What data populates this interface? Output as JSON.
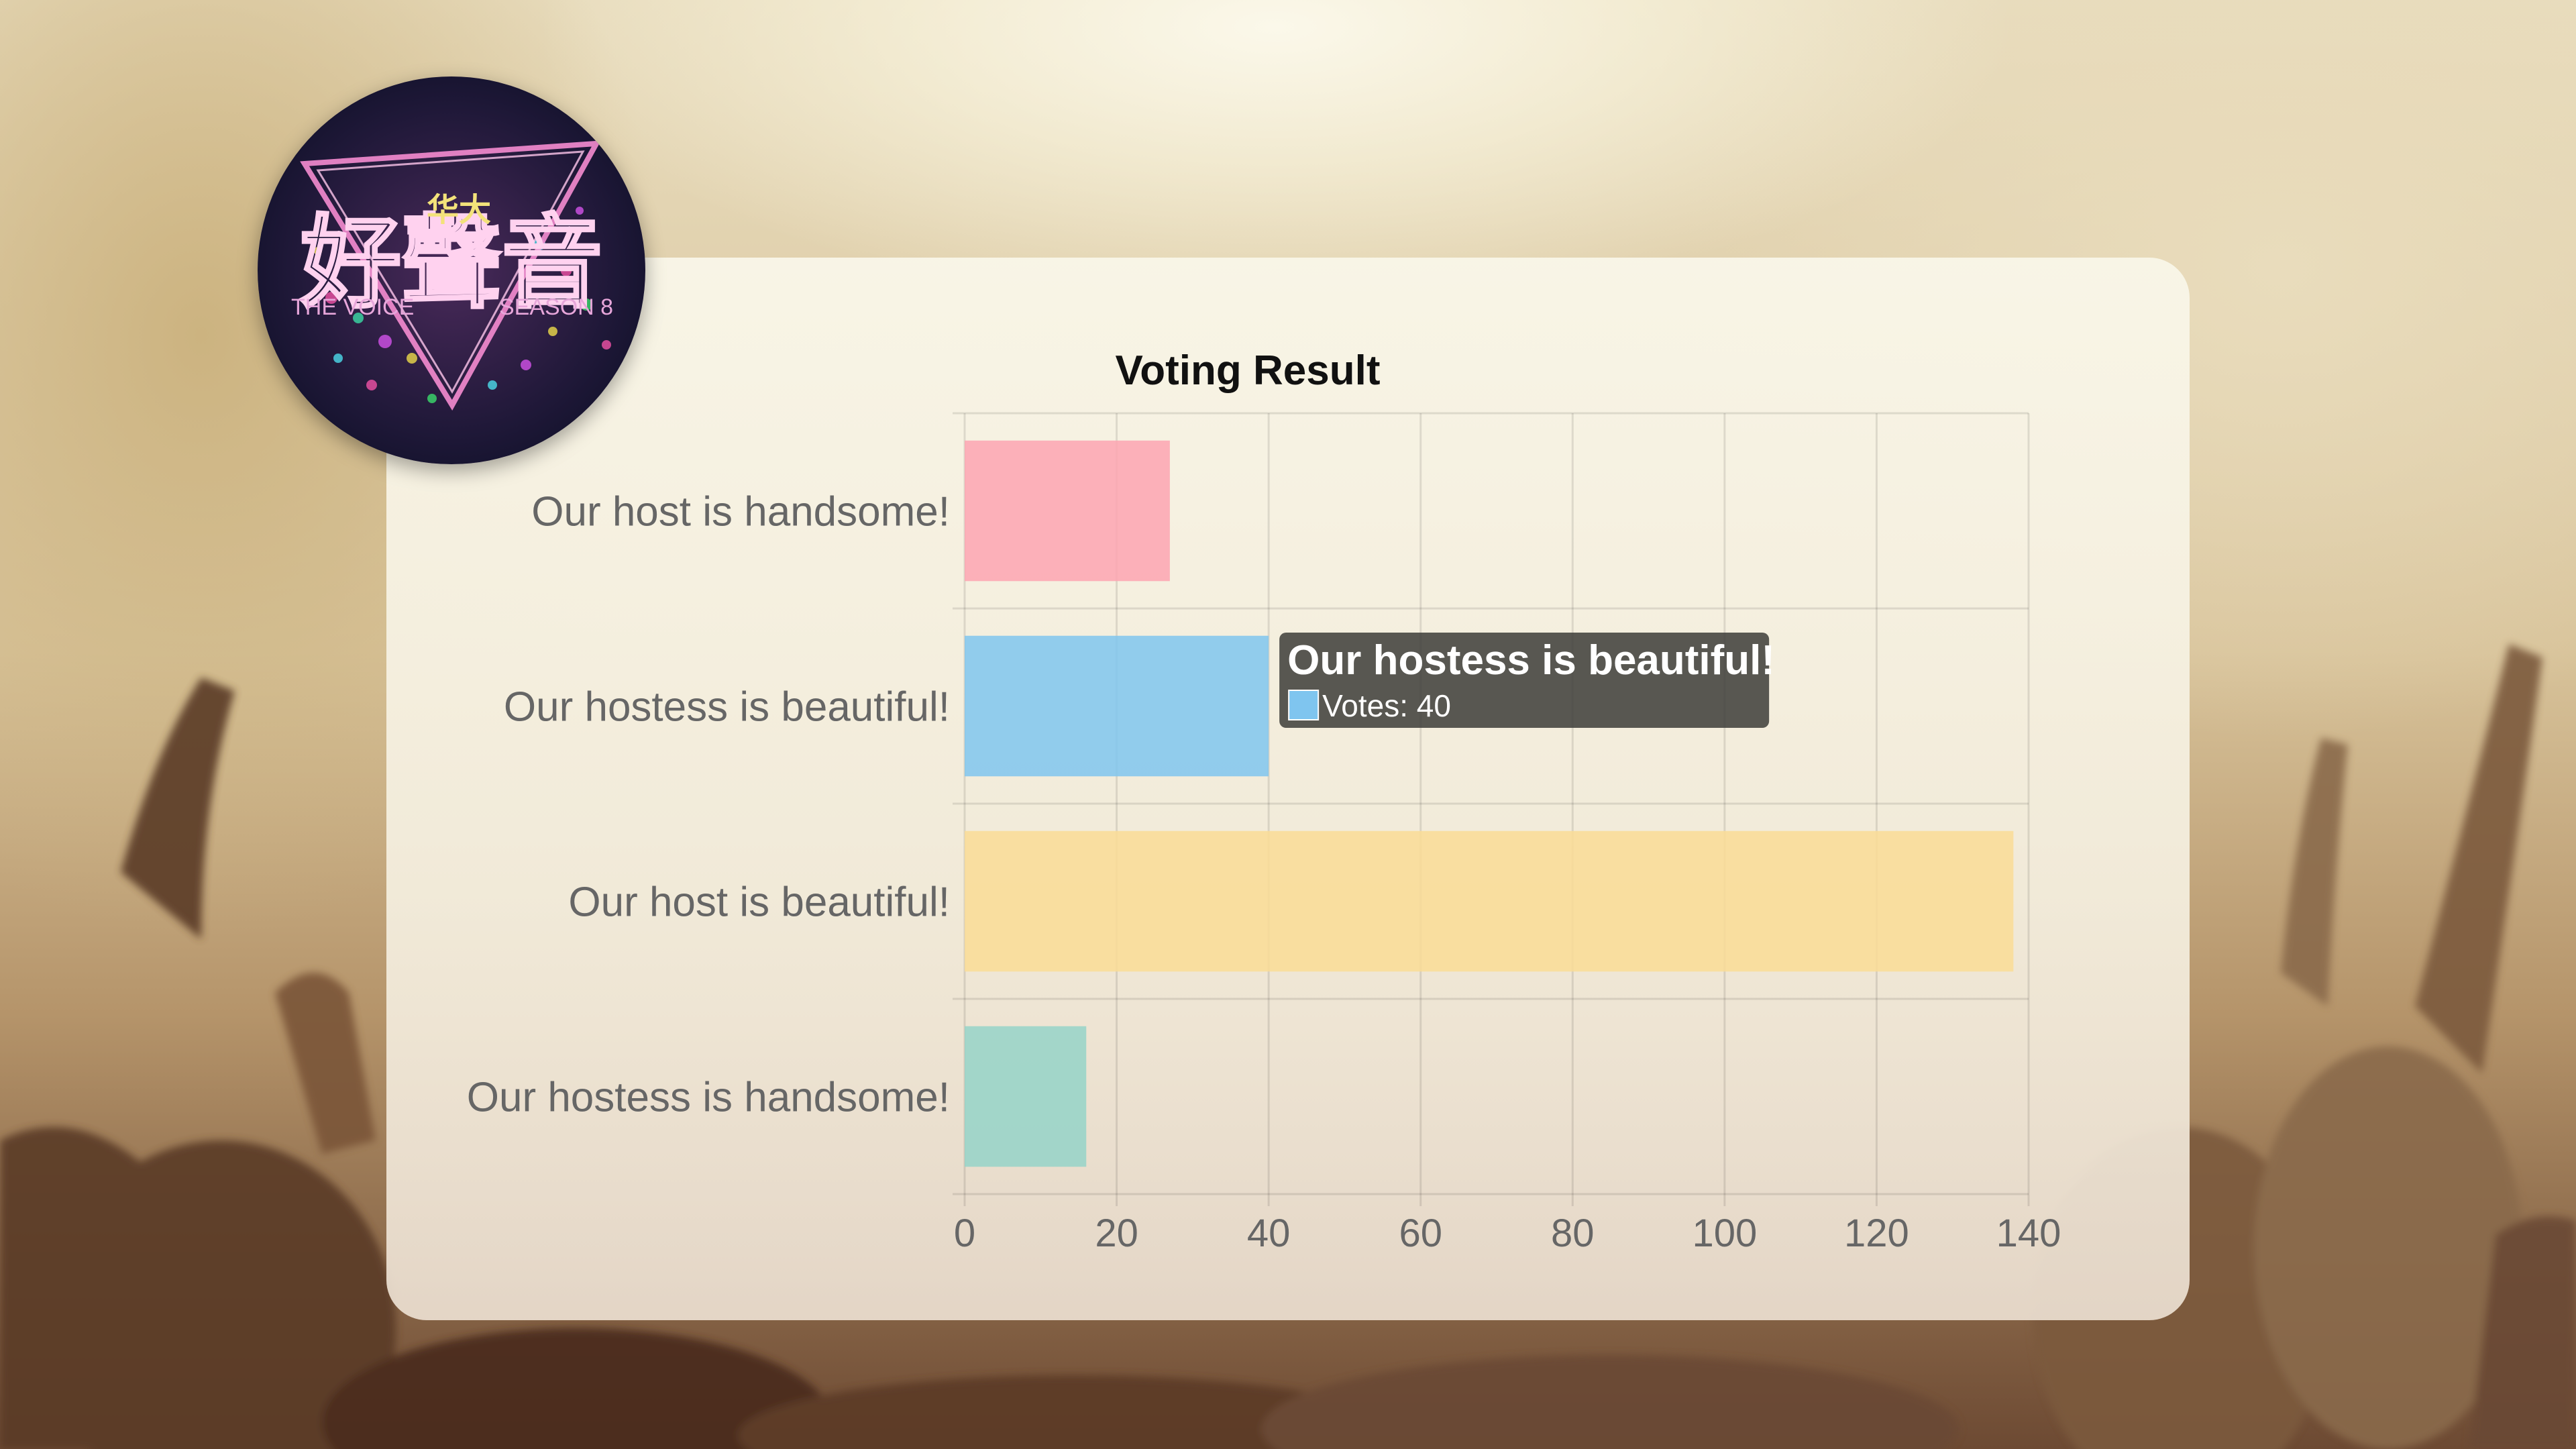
{
  "logo": {
    "title_cn": "好聲音",
    "subtitle_cn": "华大",
    "left_text": "THE VOICE",
    "right_text": "SEASON 8"
  },
  "chart_data": {
    "type": "bar",
    "orientation": "horizontal",
    "title": "Voting Result",
    "categories": [
      "Our host is handsome!",
      "Our hostess is beautiful!",
      "Our host is beautiful!",
      "Our hostess is handsome!"
    ],
    "series": [
      {
        "values": [
          27,
          40,
          138,
          16
        ]
      }
    ],
    "colors": [
      "#fda4b1",
      "#7fc5ef",
      "#fadc95",
      "#95d3c8"
    ],
    "xlim": [
      0,
      140
    ],
    "xticks": [
      0,
      20,
      40,
      60,
      80,
      100,
      120,
      140
    ],
    "grid": true,
    "legend": "none",
    "tooltip": {
      "category_index": 1,
      "title": "Our hostess is beautiful!",
      "body": "Votes: 40",
      "swatch_color": "#7fc5ef"
    }
  }
}
